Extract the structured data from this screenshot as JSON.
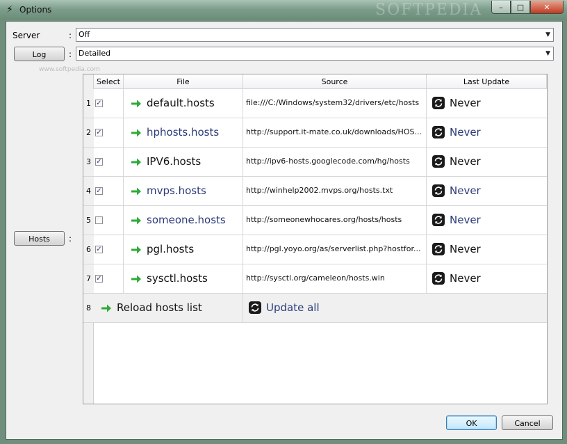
{
  "window": {
    "title": "Options",
    "title_ghost": "SOFTPEDIA"
  },
  "form": {
    "server_label": "Server",
    "server_value": "Off",
    "log_button": "Log",
    "log_value": "Detailed",
    "hosts_button": "Hosts",
    "colon": ":",
    "watermark": "www.softpedia.com"
  },
  "table": {
    "headers": {
      "select": "Select",
      "file": "File",
      "source": "Source",
      "last_update": "Last Update"
    },
    "rows": [
      {
        "num": "1",
        "checked": true,
        "file": "default.hosts",
        "source": "file:///C:/Windows/system32/drivers/etc/hosts",
        "last_update": "Never",
        "hover": false
      },
      {
        "num": "2",
        "checked": true,
        "file": "hphosts.hosts",
        "source": "http://support.it-mate.co.uk/downloads/HOS...",
        "last_update": "Never",
        "hover": true
      },
      {
        "num": "3",
        "checked": true,
        "file": "IPV6.hosts",
        "source": "http://ipv6-hosts.googlecode.com/hg/hosts",
        "last_update": "Never",
        "hover": false
      },
      {
        "num": "4",
        "checked": true,
        "file": "mvps.hosts",
        "source": "http://winhelp2002.mvps.org/hosts.txt",
        "last_update": "Never",
        "hover": true
      },
      {
        "num": "5",
        "checked": false,
        "file": "someone.hosts",
        "source": "http://someonewhocares.org/hosts/hosts",
        "last_update": "Never",
        "hover": true
      },
      {
        "num": "6",
        "checked": true,
        "file": "pgl.hosts",
        "source": "http://pgl.yoyo.org/as/serverlist.php?hostfor...",
        "last_update": "Never",
        "hover": false
      },
      {
        "num": "7",
        "checked": true,
        "file": "sysctl.hosts",
        "source": "http://sysctl.org/cameleon/hosts.win",
        "last_update": "Never",
        "hover": false
      }
    ],
    "footer": {
      "num": "8",
      "reload_label": "Reload hosts list",
      "update_all_label": "Update all"
    }
  },
  "buttons": {
    "ok": "OK",
    "cancel": "Cancel"
  },
  "caption_buttons": {
    "minimize": "–",
    "maximize": "□",
    "close": "✕"
  },
  "colors": {
    "link_text": "#2b3a7a",
    "arrow_green": "#2eaa3a",
    "ok_border": "#3c7fb1"
  },
  "icons": {
    "title": "bolt-icon",
    "file_arrow": "green-arrow-icon",
    "update": "refresh-icon",
    "checkbox_mark": "✓"
  }
}
